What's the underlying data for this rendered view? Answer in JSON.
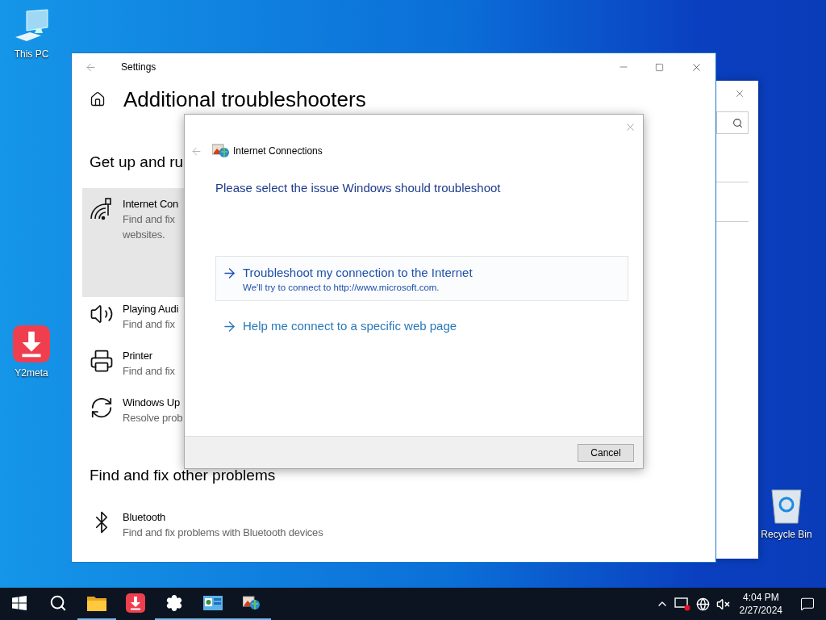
{
  "desktop_icons": [
    {
      "label": "This PC",
      "kind": "pc"
    },
    {
      "label": "Y2meta",
      "kind": "y2meta"
    },
    {
      "label": "Recycle Bin",
      "kind": "bin"
    }
  ],
  "settings_window": {
    "title": "Settings",
    "heading": "Additional troubleshooters",
    "section_1": {
      "title": "Get up and ru",
      "items": [
        {
          "kind": "internet",
          "title": "Internet Con",
          "description": "Find and fix",
          "description_2": "websites.",
          "selected": true
        },
        {
          "kind": "audio",
          "title": "Playing Audi",
          "description": "Find and fix",
          "selected": false
        },
        {
          "kind": "printer",
          "title": "Printer",
          "description": "Find and fix",
          "selected": false
        },
        {
          "kind": "update",
          "title": "Windows Up",
          "description": "Resolve prob",
          "selected": false
        }
      ]
    },
    "section_2": {
      "title": "Find and fix other problems",
      "items": [
        {
          "kind": "bluetooth",
          "title": "Bluetooth",
          "description": "Find and fix problems with Bluetooth devices",
          "selected": false
        }
      ]
    }
  },
  "dialog": {
    "title": "Internet Connections",
    "prompt": "Please select the issue Windows should troubleshoot",
    "options": [
      {
        "title": "Troubleshoot my connection to the Internet",
        "subtitle": "We'll try to connect to http://www.microsoft.com.",
        "selected": true
      },
      {
        "title": "Help me connect to a specific web page",
        "selected": false
      }
    ],
    "buttons": [
      "Cancel"
    ]
  },
  "taskbar": {
    "apps": [
      {
        "kind": "start",
        "open": false
      },
      {
        "kind": "search",
        "open": false
      },
      {
        "kind": "explorer",
        "open": true
      },
      {
        "kind": "y2meta",
        "open": false
      },
      {
        "kind": "settings",
        "open": true
      },
      {
        "kind": "control",
        "open": true
      },
      {
        "kind": "network",
        "open": true
      }
    ],
    "time": "4:04 PM",
    "date": "2/27/2024"
  }
}
